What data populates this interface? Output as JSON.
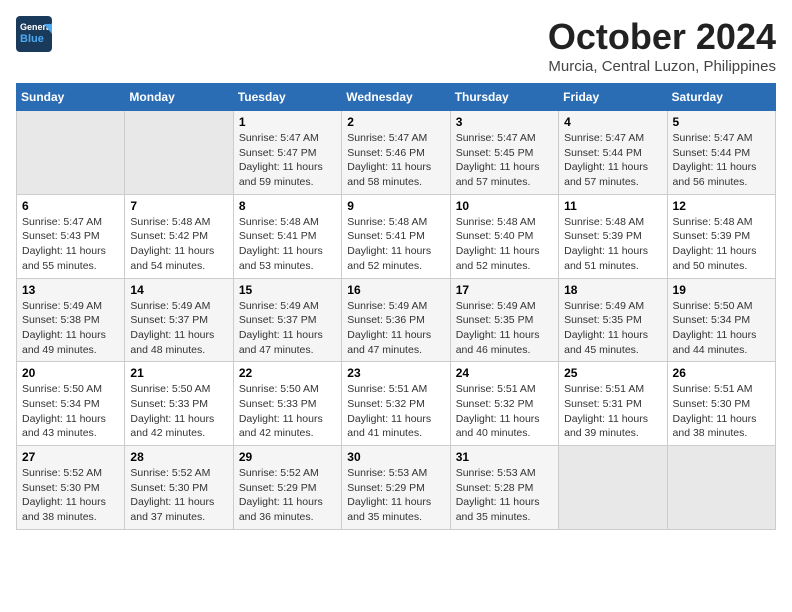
{
  "header": {
    "logo_line1": "General",
    "logo_line2": "Blue",
    "month": "October 2024",
    "location": "Murcia, Central Luzon, Philippines"
  },
  "weekdays": [
    "Sunday",
    "Monday",
    "Tuesday",
    "Wednesday",
    "Thursday",
    "Friday",
    "Saturday"
  ],
  "weeks": [
    [
      {
        "day": "",
        "detail": ""
      },
      {
        "day": "",
        "detail": ""
      },
      {
        "day": "1",
        "detail": "Sunrise: 5:47 AM\nSunset: 5:47 PM\nDaylight: 11 hours and 59 minutes."
      },
      {
        "day": "2",
        "detail": "Sunrise: 5:47 AM\nSunset: 5:46 PM\nDaylight: 11 hours and 58 minutes."
      },
      {
        "day": "3",
        "detail": "Sunrise: 5:47 AM\nSunset: 5:45 PM\nDaylight: 11 hours and 57 minutes."
      },
      {
        "day": "4",
        "detail": "Sunrise: 5:47 AM\nSunset: 5:44 PM\nDaylight: 11 hours and 57 minutes."
      },
      {
        "day": "5",
        "detail": "Sunrise: 5:47 AM\nSunset: 5:44 PM\nDaylight: 11 hours and 56 minutes."
      }
    ],
    [
      {
        "day": "6",
        "detail": "Sunrise: 5:47 AM\nSunset: 5:43 PM\nDaylight: 11 hours and 55 minutes."
      },
      {
        "day": "7",
        "detail": "Sunrise: 5:48 AM\nSunset: 5:42 PM\nDaylight: 11 hours and 54 minutes."
      },
      {
        "day": "8",
        "detail": "Sunrise: 5:48 AM\nSunset: 5:41 PM\nDaylight: 11 hours and 53 minutes."
      },
      {
        "day": "9",
        "detail": "Sunrise: 5:48 AM\nSunset: 5:41 PM\nDaylight: 11 hours and 52 minutes."
      },
      {
        "day": "10",
        "detail": "Sunrise: 5:48 AM\nSunset: 5:40 PM\nDaylight: 11 hours and 52 minutes."
      },
      {
        "day": "11",
        "detail": "Sunrise: 5:48 AM\nSunset: 5:39 PM\nDaylight: 11 hours and 51 minutes."
      },
      {
        "day": "12",
        "detail": "Sunrise: 5:48 AM\nSunset: 5:39 PM\nDaylight: 11 hours and 50 minutes."
      }
    ],
    [
      {
        "day": "13",
        "detail": "Sunrise: 5:49 AM\nSunset: 5:38 PM\nDaylight: 11 hours and 49 minutes."
      },
      {
        "day": "14",
        "detail": "Sunrise: 5:49 AM\nSunset: 5:37 PM\nDaylight: 11 hours and 48 minutes."
      },
      {
        "day": "15",
        "detail": "Sunrise: 5:49 AM\nSunset: 5:37 PM\nDaylight: 11 hours and 47 minutes."
      },
      {
        "day": "16",
        "detail": "Sunrise: 5:49 AM\nSunset: 5:36 PM\nDaylight: 11 hours and 47 minutes."
      },
      {
        "day": "17",
        "detail": "Sunrise: 5:49 AM\nSunset: 5:35 PM\nDaylight: 11 hours and 46 minutes."
      },
      {
        "day": "18",
        "detail": "Sunrise: 5:49 AM\nSunset: 5:35 PM\nDaylight: 11 hours and 45 minutes."
      },
      {
        "day": "19",
        "detail": "Sunrise: 5:50 AM\nSunset: 5:34 PM\nDaylight: 11 hours and 44 minutes."
      }
    ],
    [
      {
        "day": "20",
        "detail": "Sunrise: 5:50 AM\nSunset: 5:34 PM\nDaylight: 11 hours and 43 minutes."
      },
      {
        "day": "21",
        "detail": "Sunrise: 5:50 AM\nSunset: 5:33 PM\nDaylight: 11 hours and 42 minutes."
      },
      {
        "day": "22",
        "detail": "Sunrise: 5:50 AM\nSunset: 5:33 PM\nDaylight: 11 hours and 42 minutes."
      },
      {
        "day": "23",
        "detail": "Sunrise: 5:51 AM\nSunset: 5:32 PM\nDaylight: 11 hours and 41 minutes."
      },
      {
        "day": "24",
        "detail": "Sunrise: 5:51 AM\nSunset: 5:32 PM\nDaylight: 11 hours and 40 minutes."
      },
      {
        "day": "25",
        "detail": "Sunrise: 5:51 AM\nSunset: 5:31 PM\nDaylight: 11 hours and 39 minutes."
      },
      {
        "day": "26",
        "detail": "Sunrise: 5:51 AM\nSunset: 5:30 PM\nDaylight: 11 hours and 38 minutes."
      }
    ],
    [
      {
        "day": "27",
        "detail": "Sunrise: 5:52 AM\nSunset: 5:30 PM\nDaylight: 11 hours and 38 minutes."
      },
      {
        "day": "28",
        "detail": "Sunrise: 5:52 AM\nSunset: 5:30 PM\nDaylight: 11 hours and 37 minutes."
      },
      {
        "day": "29",
        "detail": "Sunrise: 5:52 AM\nSunset: 5:29 PM\nDaylight: 11 hours and 36 minutes."
      },
      {
        "day": "30",
        "detail": "Sunrise: 5:53 AM\nSunset: 5:29 PM\nDaylight: 11 hours and 35 minutes."
      },
      {
        "day": "31",
        "detail": "Sunrise: 5:53 AM\nSunset: 5:28 PM\nDaylight: 11 hours and 35 minutes."
      },
      {
        "day": "",
        "detail": ""
      },
      {
        "day": "",
        "detail": ""
      }
    ]
  ]
}
